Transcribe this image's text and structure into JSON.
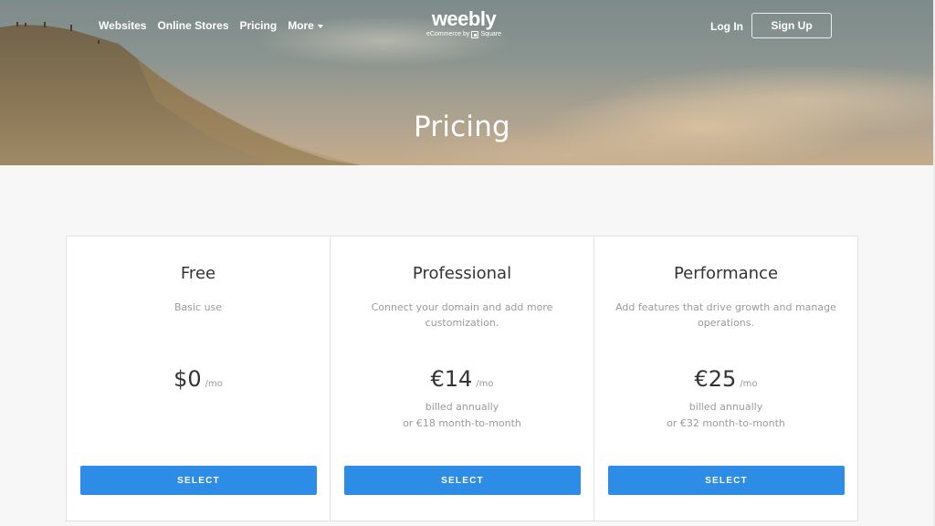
{
  "nav": {
    "links": [
      {
        "label": "Websites"
      },
      {
        "label": "Online Stores"
      },
      {
        "label": "Pricing"
      },
      {
        "label": "More",
        "has_dropdown": true
      }
    ],
    "logo": {
      "wordmark": "weebly",
      "tagline_prefix": "eCommerce by",
      "tagline_brand": "Square"
    },
    "login_label": "Log In",
    "signup_label": "Sign Up"
  },
  "hero": {
    "title": "Pricing"
  },
  "plans": [
    {
      "name": "Free",
      "description": "Basic use",
      "price": "$0",
      "period": "/mo",
      "billing_line1": "",
      "billing_line2": "",
      "button_label": "SELECT"
    },
    {
      "name": "Professional",
      "description": "Connect your domain and add more customization.",
      "price": "€14",
      "period": "/mo",
      "billing_line1": "billed annually",
      "billing_line2": "or €18 month-to-month",
      "button_label": "SELECT"
    },
    {
      "name": "Performance",
      "description": "Add features that drive growth and manage operations.",
      "price": "€25",
      "period": "/mo",
      "billing_line1": "billed annually",
      "billing_line2": "or €32 month-to-month",
      "button_label": "SELECT"
    }
  ],
  "colors": {
    "accent": "#2d8de6",
    "page_background": "#f7f7f7",
    "text_primary": "#333333",
    "text_muted": "#9a9a9a"
  }
}
